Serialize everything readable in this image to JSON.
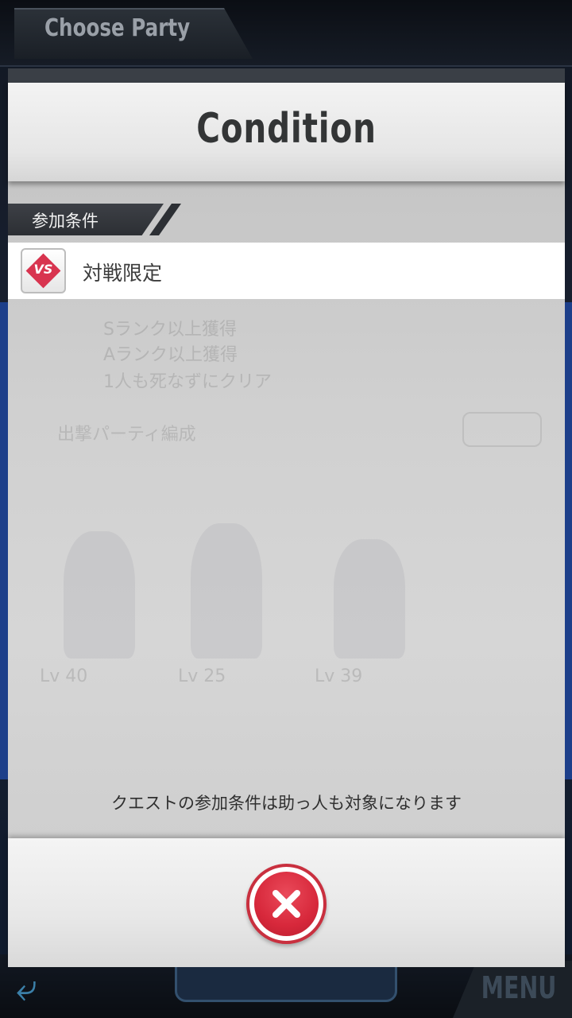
{
  "background": {
    "header_title": "Choose Party",
    "menu_label": "MENU",
    "ghost_lines": [
      "Sランク以上獲得",
      "Aランク以上獲得",
      "1人も死なずにクリア",
      "出撃パーティ編成"
    ],
    "ghost_levels": [
      "Lv 40",
      "Lv 25",
      "Lv 39"
    ]
  },
  "modal": {
    "title": "Condition",
    "section_label": "参加条件",
    "conditions": [
      {
        "icon": "vs-icon",
        "badge_text": "VS",
        "label": "対戦限定"
      }
    ],
    "note": "クエストの参加条件は助っ人も対象になります",
    "close_button": "close-icon"
  },
  "colors": {
    "accent_red": "#d8344f",
    "close_ring": "#c9303f"
  }
}
